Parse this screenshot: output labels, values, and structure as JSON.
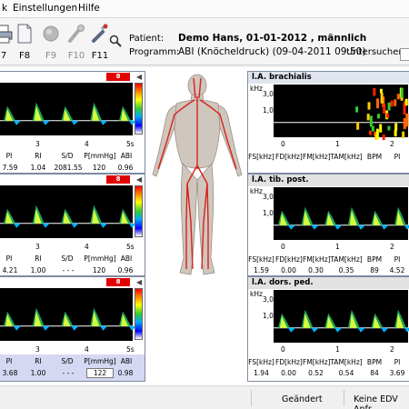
{
  "menu": {
    "items": [
      "k",
      "Einstellungen",
      "Hilfe"
    ]
  },
  "toolbar": {
    "buttons": [
      {
        "label": "7",
        "icon": "print-icon",
        "enabled": true
      },
      {
        "label": "F8",
        "icon": "document-icon",
        "enabled": true
      },
      {
        "label": "F9",
        "icon": "record-icon",
        "enabled": false
      },
      {
        "label": "F10",
        "icon": "probe-icon",
        "enabled": false
      },
      {
        "label": "F11",
        "icon": "syringe-icon",
        "enabled": true
      },
      {
        "label": "",
        "icon": "search-icon",
        "enabled": true
      }
    ]
  },
  "patient": {
    "patient_label": "Patient:",
    "patient_value": "Demo Hans, 01-01-2012 , männlich",
    "program_label": "Programm:",
    "program_value": "ABI (Knöcheldruck) (09-04-2011 09:50)",
    "examiner_label": "Untersucher:"
  },
  "colors": {
    "panel_border": "#7d8aa0",
    "panel_header": "#dfe4ee",
    "badge_red": "#e00000",
    "baseline": "#ffffff"
  },
  "left_panels": [
    {
      "badge": "8",
      "ticks": [
        "3",
        "4",
        "5s"
      ],
      "metric_labels": [
        "PI",
        "RI",
        "S/D",
        "P[mmHg]",
        "ABI"
      ],
      "metric_values": [
        "7.59",
        "1.04",
        "2081.55",
        "120",
        "0.96"
      ]
    },
    {
      "badge": "8",
      "ticks": [
        "3",
        "4",
        "5s"
      ],
      "metric_labels": [
        "PI",
        "RI",
        "S/D",
        "P[mmHg]",
        "ABI"
      ],
      "metric_values": [
        "4.21",
        "1.00",
        "- - -",
        "120",
        "0.96"
      ]
    },
    {
      "badge": "8",
      "ticks": [
        "3",
        "4",
        "5s"
      ],
      "metric_labels": [
        "PI",
        "RI",
        "S/D",
        "P[mmHg]",
        "ABI"
      ],
      "metric_values": [
        "3.68",
        "1.00",
        "- - -",
        "122",
        "0.98"
      ]
    }
  ],
  "right_panels": [
    {
      "title": "l.A. brachialis",
      "unit": "kHz",
      "y_top": "3,0",
      "y_mid": "1,0",
      "ticks": [
        "0",
        "1",
        "2"
      ],
      "metric_labels": [
        "FS[kHz]",
        "FD[kHz]",
        "FM[kHz]",
        "TAM[kHz]",
        "BPM",
        "PI"
      ],
      "metric_values": [
        "",
        "",
        "",
        "",
        "",
        ""
      ]
    },
    {
      "title": "l.A. tib. post.",
      "unit": "kHz",
      "y_top": "3,0",
      "y_mid": "1,0",
      "ticks": [
        "0",
        "1",
        "2"
      ],
      "metric_labels": [
        "FS[kHz]",
        "FD[kHz]",
        "FM[kHz]",
        "TAM[kHz]",
        "BPM",
        "PI"
      ],
      "metric_values": [
        "1.59",
        "0.00",
        "0.30",
        "0.35",
        "89",
        "4.52"
      ]
    },
    {
      "title": "l.A. dors. ped.",
      "unit": "kHz",
      "y_top": "3,0",
      "y_mid": "1,0",
      "ticks": [
        "0",
        "1",
        "2"
      ],
      "metric_labels": [
        "FS[kHz]",
        "FD[kHz]",
        "FM[kHz]",
        "TAM[kHz]",
        "BPM",
        "PI"
      ],
      "metric_values": [
        "1.94",
        "0.00",
        "0.52",
        "0.54",
        "84",
        "3.69"
      ]
    }
  ],
  "status": {
    "changed": "Geändert",
    "edv": "Keine EDV Anfr"
  }
}
